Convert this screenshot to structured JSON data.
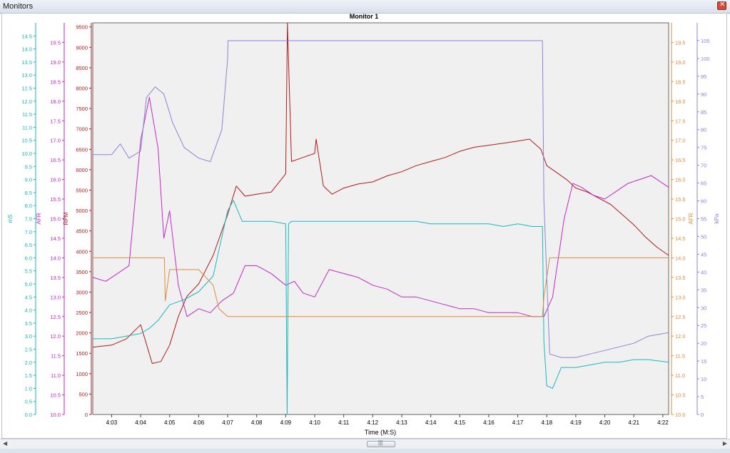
{
  "window": {
    "title": "Monitors"
  },
  "chart_data": {
    "type": "line",
    "title": "Monitor 1",
    "xlabel": "Time (M:S)",
    "x_ticks": [
      "4:03",
      "4:04",
      "4:05",
      "4:06",
      "4:07",
      "4:08",
      "4:09",
      "4:10",
      "4:11",
      "4:12",
      "4:13",
      "4:14",
      "4:15",
      "4:16",
      "4:17",
      "4:18",
      "4:19",
      "4:20",
      "4:21",
      "4:22"
    ],
    "x_tick_seconds": [
      183,
      184,
      185,
      186,
      187,
      188,
      189,
      190,
      191,
      192,
      193,
      194,
      195,
      196,
      197,
      198,
      199,
      200,
      201,
      202
    ],
    "xlim": [
      182.35,
      202.2
    ],
    "grid": false,
    "axes": [
      {
        "name": "mS",
        "side": "left",
        "color": "#17b8c0",
        "range": [
          0,
          15
        ],
        "ticks": [
          "0.0",
          "0.5",
          "1.0",
          "1.5",
          "2.0",
          "2.5",
          "3.0",
          "3.5",
          "4.0",
          "4.5",
          "5.0",
          "5.5",
          "6.0",
          "6.5",
          "7.0",
          "7.5",
          "8.0",
          "8.5",
          "9.0",
          "9.5",
          "10.0",
          "10.5",
          "11.0",
          "11.5",
          "12.0",
          "12.5",
          "13.0",
          "13.5",
          "14.0",
          "14.5"
        ]
      },
      {
        "name": "AFR",
        "side": "left",
        "color": "#c427c9",
        "range": [
          10,
          20
        ],
        "ticks": [
          "10.0",
          "10.5",
          "11.0",
          "11.5",
          "12.0",
          "12.5",
          "13.0",
          "13.5",
          "14.0",
          "14.5",
          "15.0",
          "15.5",
          "16.0",
          "16.5",
          "17.0",
          "17.5",
          "18.0",
          "18.5",
          "19.0",
          "19.5"
        ]
      },
      {
        "name": "RPM",
        "side": "left",
        "color": "#b01a1a",
        "range": [
          0,
          9600
        ],
        "ticks": [
          "0",
          "500",
          "1000",
          "1500",
          "2000",
          "2500",
          "3000",
          "3500",
          "4000",
          "4500",
          "5000",
          "5500",
          "6000",
          "6500",
          "7000",
          "7500",
          "8000",
          "8500",
          "9000",
          "9500"
        ]
      },
      {
        "name": "AFR",
        "side": "right",
        "color": "#e08a3c",
        "range": [
          10,
          20
        ],
        "ticks": [
          "10.0",
          "10.5",
          "11.0",
          "11.5",
          "12.0",
          "12.5",
          "13.0",
          "13.5",
          "14.0",
          "14.5",
          "15.0",
          "15.5",
          "16.0",
          "16.5",
          "17.0",
          "17.5",
          "18.0",
          "18.5",
          "19.0",
          "19.5"
        ]
      },
      {
        "name": "kPa",
        "side": "right",
        "color": "#8a84d8",
        "range": [
          0,
          110
        ],
        "ticks": [
          "0",
          "5",
          "10",
          "15",
          "20",
          "25",
          "30",
          "35",
          "40",
          "45",
          "50",
          "55",
          "60",
          "65",
          "70",
          "75",
          "80",
          "85",
          "90",
          "95",
          "100",
          "105"
        ]
      }
    ],
    "series": [
      {
        "axis": 2,
        "color": "#b01a1a",
        "x": [
          182.35,
          183,
          183.5,
          184,
          184.4,
          184.7,
          185,
          185.3,
          185.6,
          186,
          186.5,
          187,
          187.3,
          187.6,
          188,
          188.5,
          189,
          189.06,
          189.2,
          189.6,
          190,
          190.05,
          190.3,
          190.6,
          191,
          191.5,
          192,
          192.5,
          193,
          193.5,
          194,
          194.5,
          195,
          195.5,
          196,
          196.5,
          197,
          197.4,
          197.8,
          198,
          198.3,
          198.7,
          199,
          199.4,
          199.8,
          200.2,
          200.6,
          201,
          201.4,
          201.8,
          202.2
        ],
        "y": [
          1650,
          1700,
          1850,
          2200,
          1250,
          1300,
          1700,
          2400,
          2900,
          3200,
          3900,
          4900,
          5600,
          5350,
          5400,
          5450,
          5900,
          9600,
          6200,
          6300,
          6400,
          6750,
          5600,
          5400,
          5550,
          5650,
          5700,
          5850,
          5950,
          6100,
          6200,
          6300,
          6450,
          6550,
          6600,
          6650,
          6700,
          6750,
          6500,
          6100,
          5950,
          5750,
          5550,
          5450,
          5300,
          5150,
          4900,
          4650,
          4350,
          4100,
          3900
        ]
      },
      {
        "axis": 1,
        "color": "#c427c9",
        "x": [
          182.35,
          182.8,
          183.2,
          183.6,
          184,
          184.3,
          184.6,
          184.8,
          185,
          185.3,
          185.6,
          186,
          186.4,
          186.8,
          187.2,
          187.6,
          188,
          188.5,
          189,
          189.3,
          189.6,
          190,
          190.5,
          191,
          191.5,
          192,
          192.5,
          193,
          193.5,
          194,
          194.5,
          195,
          195.5,
          196,
          196.5,
          197,
          197.5,
          197.9,
          198.2,
          198.6,
          198.9,
          199.2,
          199.6,
          200,
          200.4,
          200.8,
          201.2,
          201.6,
          202.2
        ],
        "y": [
          13.5,
          13.4,
          13.6,
          13.8,
          17.0,
          18.1,
          16.8,
          14.5,
          15.2,
          13.3,
          12.5,
          12.7,
          12.6,
          12.9,
          13.1,
          13.8,
          13.8,
          13.6,
          13.3,
          13.4,
          13.1,
          13.0,
          13.7,
          13.6,
          13.5,
          13.3,
          13.2,
          13.0,
          13.0,
          12.9,
          12.8,
          12.7,
          12.7,
          12.6,
          12.6,
          12.6,
          12.5,
          12.5,
          13.0,
          15.0,
          15.9,
          15.8,
          15.6,
          15.5,
          15.7,
          15.9,
          16.0,
          16.1,
          15.8
        ]
      },
      {
        "axis": 0,
        "color": "#17b8c0",
        "x": [
          182.35,
          183,
          183.5,
          184,
          184.3,
          184.6,
          185,
          185.5,
          186,
          186.5,
          187,
          187.2,
          187.5,
          188,
          188.5,
          189,
          189.05,
          189.1,
          189.2,
          189.6,
          190,
          190.5,
          191,
          191.5,
          192,
          192.5,
          193,
          193.5,
          194,
          194.5,
          195,
          195.5,
          196,
          196.5,
          197,
          197.5,
          197.85,
          197.9,
          198,
          198.2,
          198.5,
          199,
          199.5,
          200,
          200.5,
          201,
          201.5,
          202.2
        ],
        "y": [
          2.9,
          2.9,
          3.0,
          3.1,
          3.3,
          3.6,
          4.2,
          4.4,
          4.7,
          5.3,
          7.8,
          8.2,
          7.4,
          7.4,
          7.4,
          7.3,
          0.0,
          7.3,
          7.4,
          7.4,
          7.4,
          7.4,
          7.4,
          7.4,
          7.4,
          7.4,
          7.4,
          7.4,
          7.3,
          7.3,
          7.3,
          7.3,
          7.3,
          7.2,
          7.3,
          7.2,
          7.2,
          2.8,
          1.1,
          1.0,
          1.8,
          1.8,
          1.9,
          2.0,
          2.0,
          2.1,
          2.1,
          2.0
        ]
      },
      {
        "axis": 3,
        "color": "#e08a3c",
        "x": [
          182.35,
          184.82,
          184.85,
          185,
          186,
          186.5,
          186.7,
          187,
          188,
          189,
          190,
          191,
          192,
          193,
          194,
          195,
          196,
          197,
          197.85,
          197.9,
          198.1,
          202.2
        ],
        "y": [
          14.0,
          14.0,
          12.9,
          13.7,
          13.7,
          13.3,
          12.7,
          12.5,
          12.5,
          12.5,
          12.5,
          12.5,
          12.5,
          12.5,
          12.5,
          12.5,
          12.5,
          12.5,
          12.5,
          13.0,
          14.0,
          14.0
        ]
      },
      {
        "axis": 4,
        "color": "#8a84d8",
        "x": [
          182.35,
          183,
          183.3,
          183.6,
          184,
          184.2,
          184.5,
          184.8,
          185.1,
          185.5,
          186,
          186.4,
          186.8,
          187,
          187.01,
          197.85,
          197.9,
          198.1,
          198.5,
          199,
          199.5,
          200,
          200.5,
          201,
          201.5,
          202.2
        ],
        "y": [
          73,
          73,
          76,
          72,
          74,
          89,
          92,
          90,
          82,
          75,
          72,
          71,
          80,
          100,
          105,
          105,
          60,
          17,
          16,
          16,
          17,
          18,
          19,
          20,
          22,
          23
        ]
      }
    ]
  }
}
